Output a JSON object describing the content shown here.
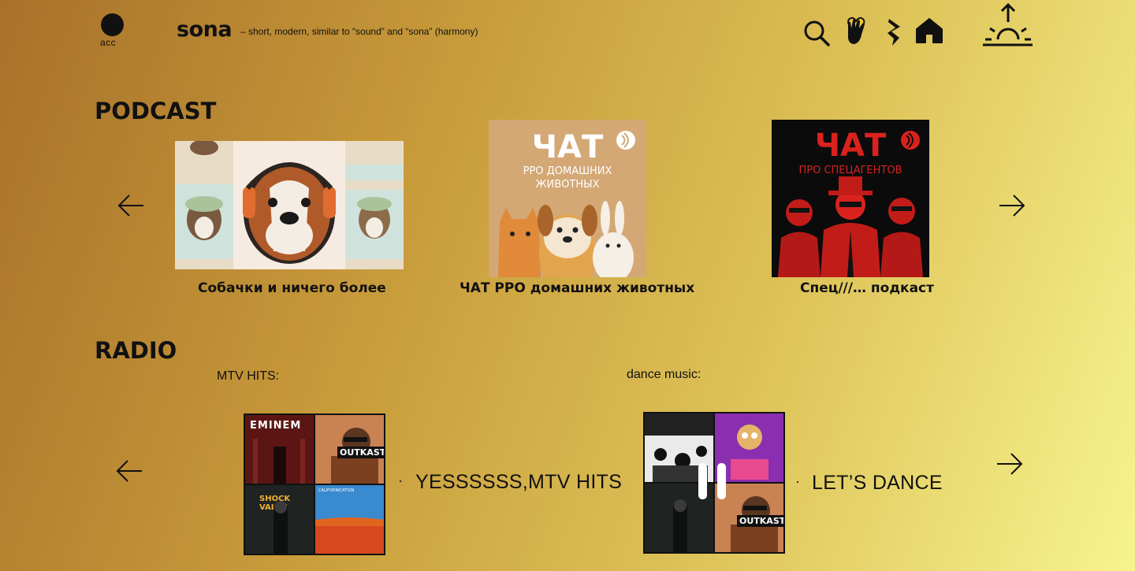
{
  "header": {
    "account_label": "acc",
    "logo": "sona",
    "tagline": "– short, modern, similar to “sound” and “sona” (harmony)",
    "icons": [
      "search-icon",
      "heart-hand-icon",
      "bolt-icon",
      "home-icon",
      "sunrise-icon"
    ]
  },
  "podcast": {
    "title": "PODCAST",
    "items": [
      {
        "caption": "Собачки и ничего более",
        "cover": "dog-headphones-collage"
      },
      {
        "caption": "ЧАТ PPO домашних животных",
        "cover_title": "ЧАТ",
        "cover_subtitle_1": "PPO ДОМАШНИХ",
        "cover_subtitle_2": "ЖИВОТНЫХ",
        "cover_colors": {
          "bg": "#d3a875",
          "text": "#ffffff"
        }
      },
      {
        "caption": "Спец///… подкаст",
        "cover_title": "ЧАТ",
        "cover_subtitle": "ПРО СПЕЦАГЕНТОВ",
        "cover_colors": {
          "bg": "#0b0b0b",
          "text": "#d9221e"
        }
      }
    ]
  },
  "radio": {
    "title": "RADIO",
    "stations": [
      {
        "subtitle": "MTV HITS:",
        "title": "YESSSSSS,MTV HITS",
        "tiles": [
          "EMINEM",
          "OUTKAST",
          "SHOCK VALUE",
          "CALIFORNICATION"
        ]
      },
      {
        "subtitle": "dance music:",
        "title": "LET’S DANCE",
        "tiles": [
          "",
          "",
          "",
          "OUTKAST"
        ]
      }
    ],
    "bullet": "·"
  },
  "colors": {
    "accent": "#111111",
    "bg_start": "#a8712a",
    "bg_end": "#f7f48e"
  }
}
